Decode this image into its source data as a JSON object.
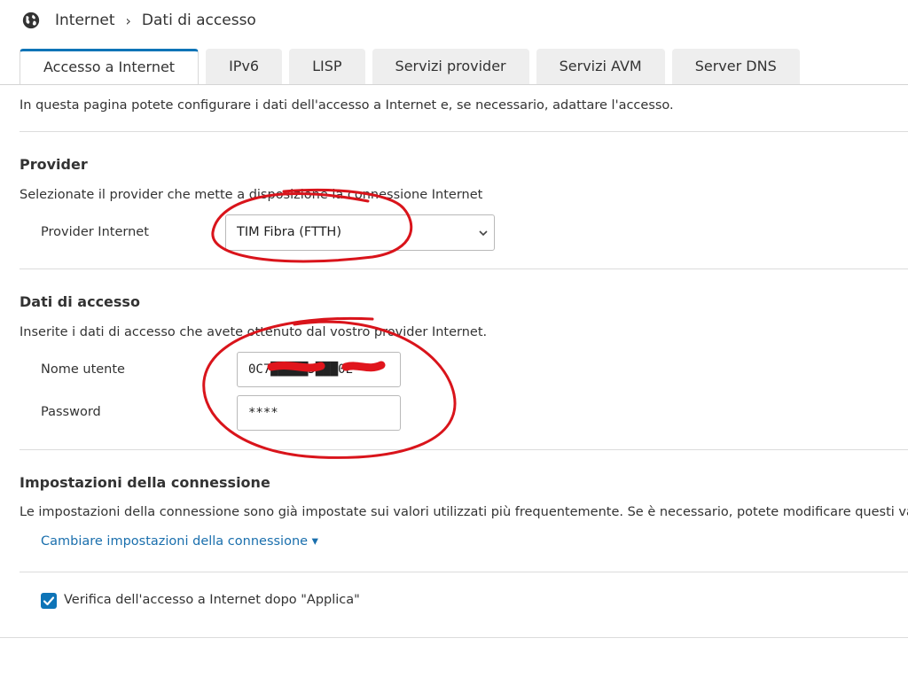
{
  "breadcrumb": {
    "parent": "Internet",
    "separator": "›",
    "current": "Dati di accesso"
  },
  "tabs": [
    {
      "label": "Accesso a Internet",
      "active": true
    },
    {
      "label": "IPv6",
      "active": false
    },
    {
      "label": "LISP",
      "active": false
    },
    {
      "label": "Servizi provider",
      "active": false
    },
    {
      "label": "Servizi AVM",
      "active": false
    },
    {
      "label": "Server DNS",
      "active": false
    }
  ],
  "intro": "In questa pagina potete configurare i dati dell'accesso a Internet e, se necessario, adattare l'accesso.",
  "provider": {
    "heading": "Provider",
    "description": "Selezionate il provider che mette a disposizione la connessione Internet",
    "label": "Provider Internet",
    "selected": "TIM Fibra (FTTH)"
  },
  "access": {
    "heading": "Dati di accesso",
    "description": "Inserite i dati di accesso che avete ottenuto dal vostro provider Internet.",
    "username_label": "Nome utente",
    "username_value": "0C7█████D███0E",
    "password_label": "Password",
    "password_value": "****"
  },
  "connection": {
    "heading": "Impostazioni della connessione",
    "description": "Le impostazioni della connessione sono già impostate sui valori utilizzati più frequentemente. Se è necessario, potete modificare questi valori.",
    "link": "Cambiare impostazioni della connessione ▾"
  },
  "verify": {
    "label": "Verifica dell'accesso a Internet dopo \"Applica\"",
    "checked": true
  },
  "colors": {
    "accent": "#0e74b7",
    "link": "#1a6fad",
    "annotation": "#d9141b"
  },
  "icons": {
    "breadcrumb": "globe-icon",
    "dropdown": "chevron-down-icon",
    "checkbox": "check-icon"
  }
}
